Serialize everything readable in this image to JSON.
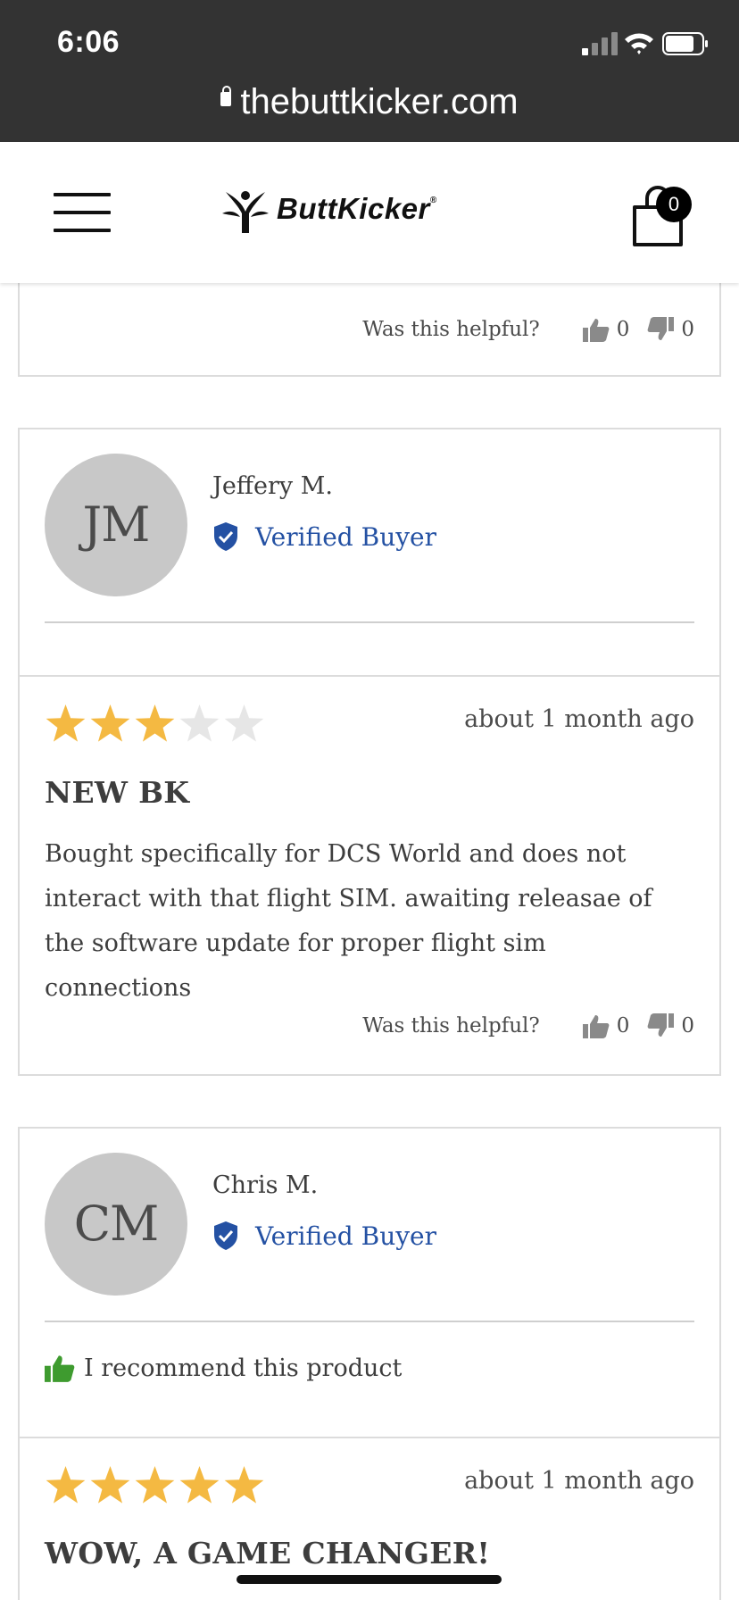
{
  "status_bar": {
    "time": "6:06",
    "url": "thebuttkicker.com"
  },
  "header": {
    "logo_text": "ButtKicker",
    "cart_count": "0"
  },
  "prev_review": {
    "helpful_label": "Was this helpful?",
    "up_count": "0",
    "down_count": "0"
  },
  "reviews": [
    {
      "initials": "JM",
      "name": "Jeffery M.",
      "verified_label": "Verified Buyer",
      "rating": 3,
      "date": "about 1 month ago",
      "title": "NEW BK",
      "body": "Bought specifically for DCS World and does not interact with that flight SIM. awaiting releasae of the software update for proper flight sim connections",
      "helpful_label": "Was this helpful?",
      "up_count": "0",
      "down_count": "0"
    },
    {
      "initials": "CM",
      "name": "Chris M.",
      "verified_label": "Verified Buyer",
      "recommend_label": "I recommend this product",
      "rating": 5,
      "date": "about 1 month ago",
      "title": "WOW, A GAME CHANGER!"
    }
  ],
  "colors": {
    "star_filled": "#f4b942",
    "star_empty": "#e6e6e6",
    "verified": "#2451a3",
    "recommend": "#3e9b2f"
  },
  "icons": [
    "signal-icon",
    "wifi-icon",
    "battery-icon",
    "lock-icon",
    "hamburger-menu-icon",
    "buttkicker-logo-icon",
    "shopping-bag-icon",
    "verified-shield-icon",
    "thumbs-up-icon",
    "thumbs-down-icon",
    "star-icon"
  ]
}
